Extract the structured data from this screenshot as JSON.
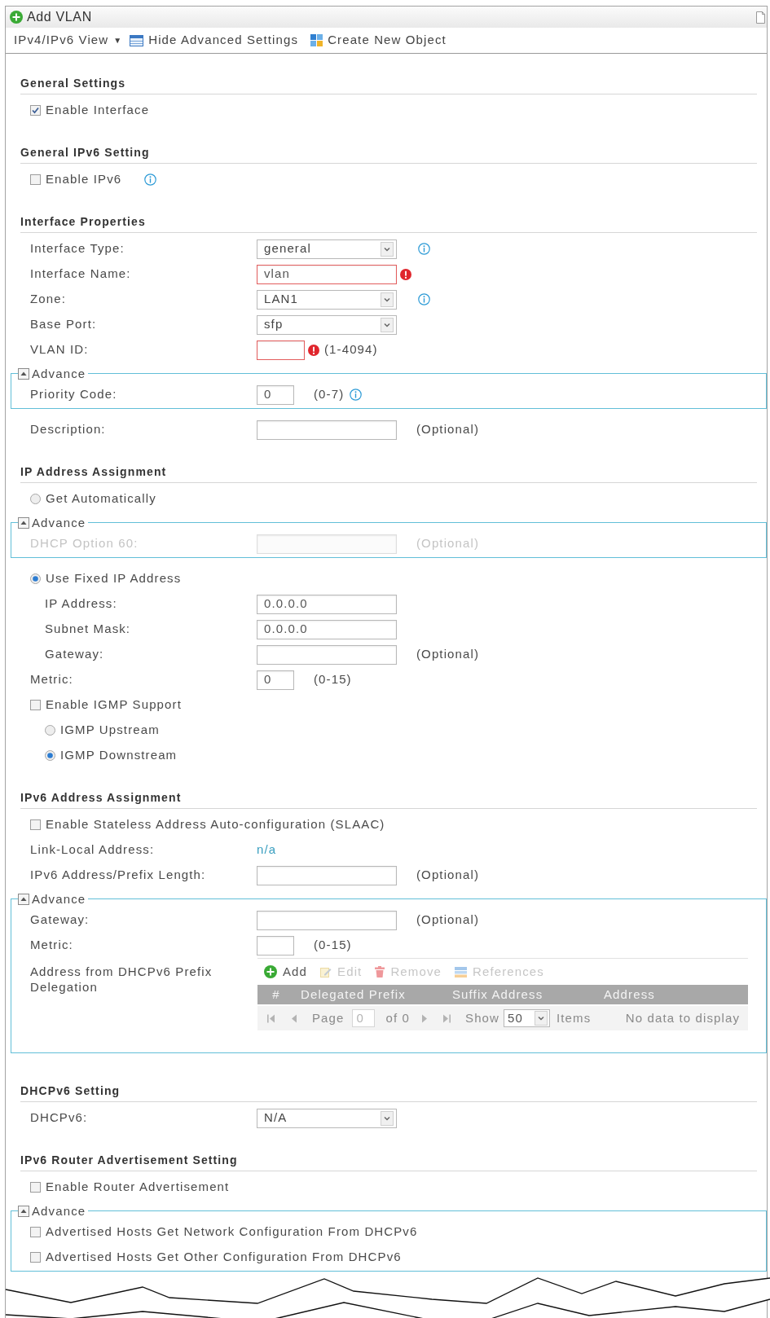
{
  "window": {
    "title": "Add VLAN"
  },
  "toolbar": [
    {
      "kind": "view_menu",
      "label": "IPv4/IPv6 View",
      "caret": "▼"
    },
    {
      "kind": "hide_advanced",
      "label": "Hide Advanced Settings"
    },
    {
      "kind": "create_object",
      "label": "Create New Object"
    }
  ],
  "sections": [
    {
      "title": "General Settings",
      "rows": [
        {
          "kind": "checkbox",
          "label": "Enable Interface",
          "checked": true
        }
      ]
    },
    {
      "title": "General IPv6 Setting",
      "rows": [
        {
          "kind": "checkbox",
          "label": "Enable IPv6",
          "checked": false,
          "info": true
        }
      ]
    },
    {
      "title": "Interface Properties",
      "rows": [
        {
          "kind": "select",
          "label": "Interface Type:",
          "value": "general",
          "info": true
        },
        {
          "kind": "input",
          "label": "Interface Name:",
          "value": "vlan",
          "error": true
        },
        {
          "kind": "select",
          "label": "Zone:",
          "value": "LAN1",
          "info": true
        },
        {
          "kind": "select",
          "label": "Base Port:",
          "value": "sfp"
        },
        {
          "kind": "mid_input",
          "label": "VLAN ID:",
          "error": true,
          "hint": "(1-4094)"
        },
        {
          "kind": "advance",
          "label": "Advance",
          "expanded": true,
          "rows": [
            {
              "kind": "short_input",
              "label": "Priority Code:",
              "value": "0",
              "hint": "(0-7)",
              "info": true
            }
          ]
        },
        {
          "kind": "input",
          "label": "Description:",
          "hint": "(Optional)"
        }
      ]
    },
    {
      "title": "IP Address Assignment",
      "rows": [
        {
          "kind": "radio",
          "label": "Get Automatically",
          "selected": false
        },
        {
          "kind": "advance",
          "label": "Advance",
          "expanded": true,
          "rows": [
            {
              "kind": "input",
              "label": "DHCP Option 60:",
              "hint": "(Optional)",
              "disabled": true
            }
          ]
        },
        {
          "kind": "radio",
          "label": "Use Fixed IP Address",
          "selected": true,
          "children": [
            {
              "kind": "input",
              "label": "IP Address:",
              "value": "0.0.0.0"
            },
            {
              "kind": "input",
              "label": "Subnet Mask:",
              "value": "0.0.0.0"
            },
            {
              "kind": "input",
              "label": "Gateway:",
              "hint": "(Optional)"
            }
          ]
        },
        {
          "kind": "short_input",
          "label": "Metric:",
          "value": "0",
          "hint": "(0-15)"
        },
        {
          "kind": "checkbox",
          "label": "Enable IGMP Support",
          "checked": false,
          "children": [
            {
              "kind": "radio",
              "label": "IGMP Upstream",
              "selected": false
            },
            {
              "kind": "radio",
              "label": "IGMP Downstream",
              "selected": true
            }
          ]
        }
      ]
    },
    {
      "title": "IPv6 Address Assignment",
      "rows": [
        {
          "kind": "checkbox",
          "label": "Enable Stateless Address Auto-configuration (SLAAC)",
          "checked": false
        },
        {
          "kind": "text",
          "label": "Link-Local Address:",
          "value": "n/a"
        },
        {
          "kind": "input",
          "label": "IPv6 Address/Prefix Length:",
          "hint": "(Optional)"
        },
        {
          "kind": "advance",
          "label": "Advance",
          "expanded": true,
          "rows": [
            {
              "kind": "input",
              "label": "Gateway:",
              "hint": "(Optional)"
            },
            {
              "kind": "short_input",
              "label": "Metric:",
              "hint": "(0-15)"
            },
            {
              "kind": "table",
              "label": "Address from DHCPv6 Prefix Delegation",
              "actions": [
                {
                  "kind": "add",
                  "label": "Add",
                  "disabled": false
                },
                {
                  "kind": "edit",
                  "label": "Edit",
                  "disabled": true
                },
                {
                  "kind": "remove",
                  "label": "Remove",
                  "disabled": true
                },
                {
                  "kind": "references",
                  "label": "References",
                  "disabled": true
                }
              ],
              "columns": [
                "#",
                "Delegated Prefix",
                "Suffix Address",
                "Address"
              ],
              "pager": {
                "page_label": "Page",
                "page": "0",
                "of": "of 0",
                "show_label": "Show",
                "per_page": "50",
                "items_label": "Items",
                "empty_text": "No data to display"
              }
            }
          ]
        }
      ]
    },
    {
      "title": "DHCPv6 Setting",
      "rows": [
        {
          "kind": "select",
          "label": "DHCPv6:",
          "value": "N/A"
        }
      ]
    },
    {
      "title": "IPv6 Router Advertisement Setting",
      "rows": [
        {
          "kind": "checkbox",
          "label": "Enable Router Advertisement",
          "checked": false
        },
        {
          "kind": "advance",
          "label": "Advance",
          "expanded": true,
          "rows": [
            {
              "kind": "checkbox",
              "label": "Advertised Hosts Get Network Configuration From DHCPv6",
              "checked": false
            },
            {
              "kind": "checkbox",
              "label": "Advertised Hosts Get Other Configuration From DHCPv6",
              "checked": false
            }
          ]
        }
      ]
    }
  ]
}
